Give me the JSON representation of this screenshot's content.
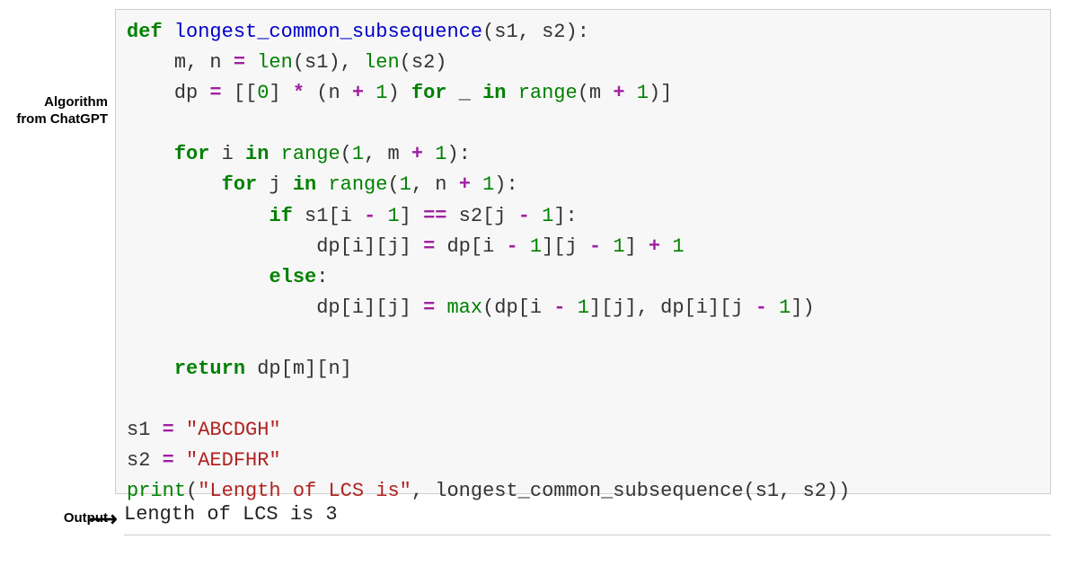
{
  "labels": {
    "algorithm": "Algorithm\nfrom ChatGPT",
    "output": "Output"
  },
  "code": {
    "kw_def": "def",
    "fn_name": "longest_common_subsequence",
    "params_open": "(s1, s2):",
    "mn_line_a": "m, n ",
    "eq": "=",
    "len1": " len",
    "len2": "len",
    "mn_line_b": "(s1), ",
    "mn_line_c": "(s2)",
    "dp_line_a": "dp ",
    "dp_line_b": " [[",
    "zero": "0",
    "dp_line_c": "] ",
    "star": "*",
    "dp_line_d": " (n ",
    "plus": "+",
    "one": "1",
    "dp_line_e": ") ",
    "kw_for": "for",
    "dp_line_f": " _ ",
    "kw_in": "in",
    "range": " range",
    "dp_line_g": "(m ",
    "dp_line_h": ")]",
    "for_i_a": " i ",
    "for_i_b": "(",
    "for_i_c": ", m ",
    "for_i_d": "):",
    "for_j_a": " j ",
    "for_j_b": ", n ",
    "kw_if": "if",
    "if_a": " s1[i ",
    "minus": "-",
    "if_b": "] ",
    "eqeq": "==",
    "if_c": " s2[j ",
    "if_d": "]:",
    "dp_set_a": "dp[i][j] ",
    "dp_set_b": " dp[i ",
    "dp_set_c": "][j ",
    "dp_set_d": "] ",
    "kw_else": "else",
    "colon": ":",
    "max_fn": " max",
    "max_a": "(dp[i ",
    "max_b": "][j], dp[i][j ",
    "max_c": "])",
    "kw_return": "return",
    "ret_a": " dp[m][n]",
    "s1_a": "s1 ",
    "s1_str": " \"ABCDGH\"",
    "s2_a": "s2 ",
    "s2_str": " \"AEDFHR\"",
    "print_fn": "print",
    "print_a": "(",
    "print_str": "\"Length of LCS is\"",
    "print_b": ", longest_common_subsequence(s1, s2))"
  },
  "output": {
    "text": "Length of LCS is 3"
  }
}
